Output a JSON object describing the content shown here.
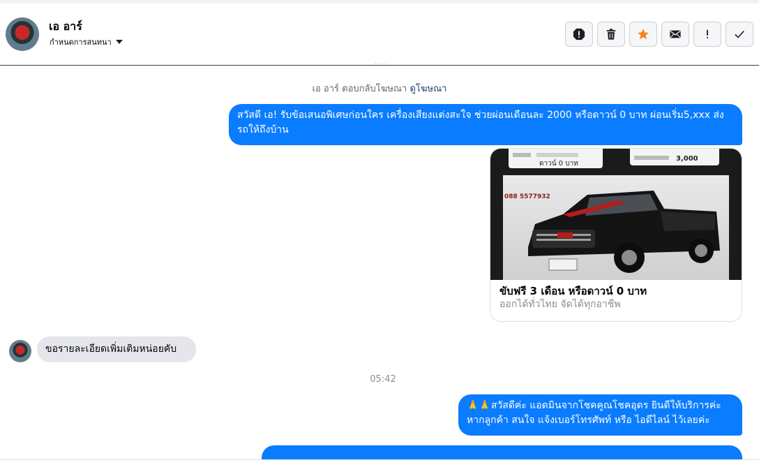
{
  "header": {
    "name": "เอ อาร์",
    "subtitle": "กำหนดการสนทนา"
  },
  "actions": [
    {
      "name": "report-icon"
    },
    {
      "name": "trash-icon"
    },
    {
      "name": "star-icon",
      "color": "#f5821f"
    },
    {
      "name": "envelope-icon"
    },
    {
      "name": "exclamation-icon"
    },
    {
      "name": "check-icon"
    }
  ],
  "conversation": {
    "ad_reply_text": "เอ อาร์ ตอบกลับโฆษณา",
    "ad_reply_link": "ดูโฆษณา",
    "messages": [
      {
        "direction": "out",
        "text": "สวัสดี เอ! รับข้อเสนอพิเศษก่อนใคร เครื่องเสียงแต่งสะใจ ช่วยผ่อนเดือนละ 2000 หรือดาวน์ 0 บาท ผ่อนเริ่ม5,xxx ส่งรถให้ถึงบ้าน"
      },
      {
        "direction": "in",
        "text": "ขอรายละเอียดเพิ่มเติมหน่อยคับ"
      },
      {
        "direction": "out",
        "text": "🙏🙏สวัสดีค่ะ แอดมินจากโชคคูณโชคอุดร ยินดีให้บริการค่ะ หากลูกค้า สนใจ แจ้งเบอร์โทรศัพท์ หรือ ไอดีไลน์  ไว้เลยค่ะ"
      }
    ],
    "ad_card": {
      "title": "ขับฟรี 3 เดือน หรือดาวน์ 0 บาท",
      "subtitle": "ออกได้ทั่วไทย จัดได้ทุกอาชีพ",
      "image_text_left": "ดาวน์ 0 บาท",
      "image_text_right": "3,000",
      "image_phone": "088 5577932"
    },
    "timestamp": "05:42"
  },
  "colors": {
    "outgoing_bubble": "#0a7cff",
    "incoming_bubble": "#e4e6eb",
    "link": "#1d3f72"
  }
}
